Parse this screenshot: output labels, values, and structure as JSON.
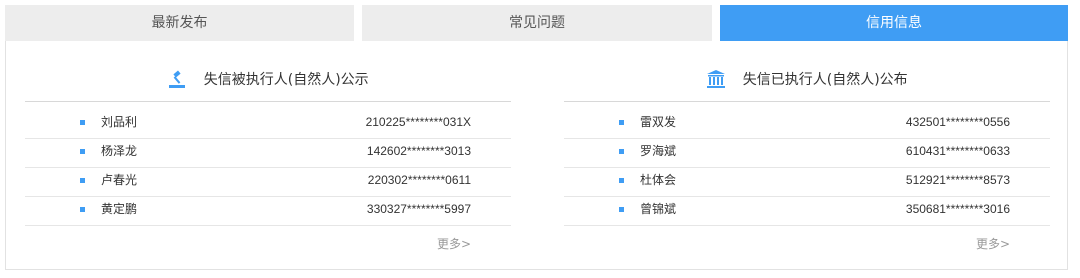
{
  "tabs": [
    {
      "label": "最新发布"
    },
    {
      "label": "常见问题"
    },
    {
      "label": "信用信息"
    }
  ],
  "colors": {
    "accent": "#3f9df4",
    "tab_inactive": "#ededed"
  },
  "left": {
    "icon": "gavel-icon",
    "title": "失信被执行人(自然人)公示",
    "rows": [
      {
        "name": "刘品利",
        "id": "210225********031X"
      },
      {
        "name": "杨泽龙",
        "id": "142602********3013"
      },
      {
        "name": "卢春光",
        "id": "220302********0611"
      },
      {
        "name": "黄定鹏",
        "id": "330327********5997"
      }
    ],
    "more": "更多>"
  },
  "right": {
    "icon": "courthouse-icon",
    "title": "失信已执行人(自然人)公布",
    "rows": [
      {
        "name": "雷双发",
        "id": "432501********0556"
      },
      {
        "name": "罗海斌",
        "id": "610431********0633"
      },
      {
        "name": "杜体会",
        "id": "512921********8573"
      },
      {
        "name": "曾锦斌",
        "id": "350681********3016"
      }
    ],
    "more": "更多>"
  }
}
